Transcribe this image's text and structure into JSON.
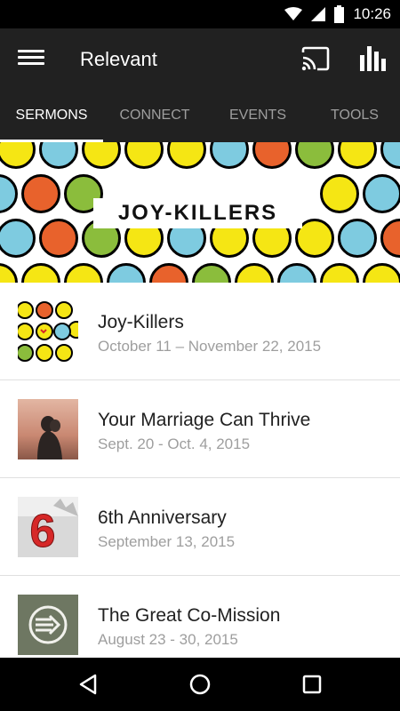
{
  "status_bar": {
    "time": "10:26"
  },
  "app_bar": {
    "title": "Relevant"
  },
  "tabs": [
    {
      "label": "SERMONS"
    },
    {
      "label": "CONNECT"
    },
    {
      "label": "EVENTS"
    },
    {
      "label": "TOOLS"
    }
  ],
  "hero": {
    "title": "JOY-KILLERS"
  },
  "sermons": [
    {
      "title": "Joy-Killers",
      "dates": "October 11 – November 22, 2015"
    },
    {
      "title": "Your Marriage Can Thrive",
      "dates": "Sept. 20 - Oct. 4, 2015"
    },
    {
      "title": "6th Anniversary",
      "dates": "September 13, 2015"
    },
    {
      "title": "The Great Co-Mission",
      "dates": "August 23 - 30, 2015"
    }
  ],
  "thumb_labels": {
    "anniversary_number": "6"
  },
  "colors": {
    "app_bar": "#212121",
    "emoji_yellow": "#f5e614",
    "emoji_blue": "#7ecbe0",
    "emoji_orange": "#e8622c",
    "emoji_green": "#8bbd3c",
    "accent_red": "#d62828"
  }
}
